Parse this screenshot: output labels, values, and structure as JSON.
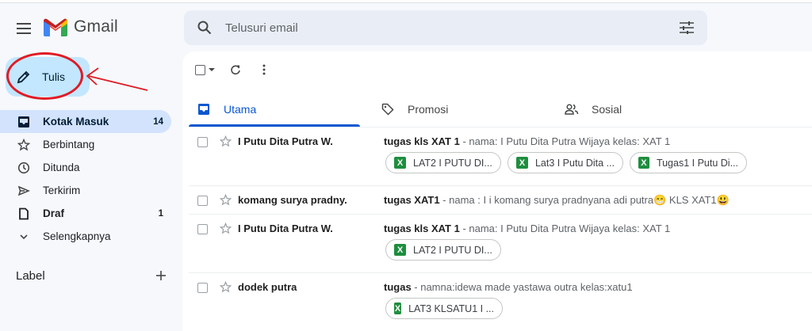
{
  "app": {
    "name": "Gmail"
  },
  "search": {
    "placeholder": "Telusuri email"
  },
  "compose": {
    "label": "Tulis"
  },
  "sidebar": {
    "items": [
      {
        "label": "Kotak Masuk",
        "count": "14",
        "icon": "inbox-icon"
      },
      {
        "label": "Berbintang",
        "count": "",
        "icon": "star-icon"
      },
      {
        "label": "Ditunda",
        "count": "",
        "icon": "clock-icon"
      },
      {
        "label": "Terkirim",
        "count": "",
        "icon": "send-icon"
      },
      {
        "label": "Draf",
        "count": "1",
        "icon": "file-icon"
      },
      {
        "label": "Selengkapnya",
        "count": "",
        "icon": "chevron-down-icon"
      }
    ],
    "labels_title": "Label"
  },
  "tabs": [
    {
      "label": "Utama",
      "icon": "inbox-icon"
    },
    {
      "label": "Promosi",
      "icon": "tag-icon"
    },
    {
      "label": "Sosial",
      "icon": "people-icon"
    }
  ],
  "emails": [
    {
      "sender": "I Putu Dita Putra W.",
      "subject": "tugas kls XAT 1",
      "snippet": " - nama: I Putu Dita Putra Wijaya kelas: XAT 1",
      "attachments": [
        "LAT2 I PUTU DI...",
        "Lat3 I Putu Dita ...",
        "Tugas1 I Putu Di..."
      ]
    },
    {
      "sender": "komang surya pradny.",
      "subject": "tugas XAT1",
      "snippet": " - nama : I i komang surya pradnyana adi putra😁 KLS XAT1😃",
      "attachments": []
    },
    {
      "sender": "I Putu Dita Putra W.",
      "subject": "tugas kls XAT 1",
      "snippet": " - nama: I Putu Dita Putra Wijaya kelas: XAT 1",
      "attachments": [
        "LAT2 I PUTU DI..."
      ]
    },
    {
      "sender": "dodek putra",
      "subject": "tugas",
      "snippet": " - namna:idewa made yastawa outra kelas:xatu1",
      "attachments": [
        "LAT3 KLSATU1 I ..."
      ]
    }
  ],
  "attachment_badge": "X",
  "colors": {
    "accent": "#0b57d0",
    "compose_bg": "#c2e7ff",
    "active_nav": "#d3e3fd",
    "annotation": "#e01b24",
    "excel": "#1e8e3e"
  }
}
